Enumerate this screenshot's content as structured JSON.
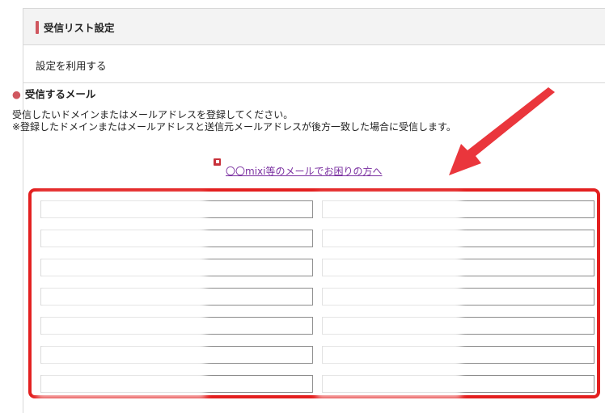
{
  "header": {
    "title": "受信リスト設定"
  },
  "setting": {
    "label": "設定を利用する"
  },
  "section": {
    "title": "受信するメール",
    "desc_line1": "受信したいドメインまたはメールアドレスを登録してください。",
    "desc_line2": "※登録したドメインまたはメールアドレスと送信元メールアドレスが後方一致した場合に受信します。",
    "link": "〇〇mixi等のメールでお困りの方へ"
  },
  "inputs": {
    "left": [
      "",
      "",
      "",
      "",
      "",
      "",
      ""
    ],
    "right": [
      "",
      "",
      "",
      "",
      "",
      "",
      ""
    ]
  },
  "colors": {
    "accent": "#d0575f",
    "highlight": "#e32020"
  }
}
